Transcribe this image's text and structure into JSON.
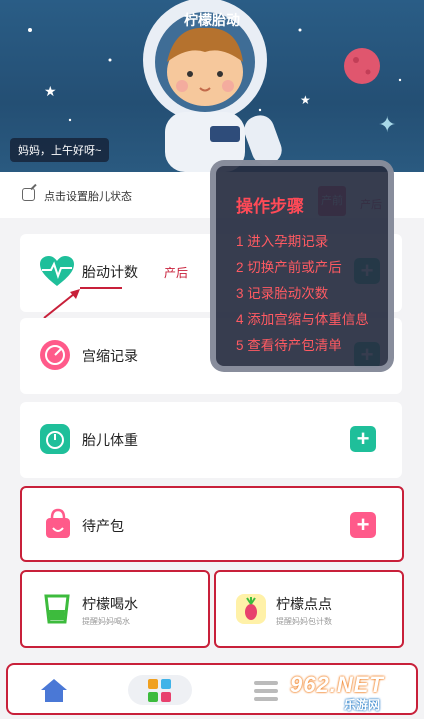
{
  "header": {
    "title": "柠檬胎动",
    "greeting": "妈妈，上午好呀~"
  },
  "status": {
    "label": "点击设置胎儿状态",
    "pre_label": "产前",
    "post_label": "产后"
  },
  "cards": {
    "fetal_movement": {
      "label": "胎动计数",
      "mode": "产后"
    },
    "contraction": {
      "label": "宫缩记录"
    },
    "fetal_weight": {
      "label": "胎儿体重"
    },
    "hospital_bag": {
      "label": "待产包"
    },
    "water": {
      "label": "柠檬喝水",
      "sub": "提醒妈妈喝水"
    },
    "dots": {
      "label": "柠檬点点",
      "sub": "提醒妈妈包计数"
    }
  },
  "overlay": {
    "title": "操作步骤",
    "steps": [
      "1 进入孕期记录",
      "2 切换产前或产后",
      "3 记录胎动次数",
      "4 添加宫缩与体重信息",
      "5 查看待产包清单"
    ]
  },
  "watermark": {
    "main": "962.NET",
    "sub": "乐游网"
  },
  "colors": {
    "accent": "#e8416d",
    "teal": "#1fbf9a",
    "header": "#2a5d86",
    "highlight": "#c8203a"
  },
  "icons": [
    "heart-pulse-icon",
    "gauge-icon",
    "scale-icon",
    "bag-icon",
    "cup-icon",
    "radish-icon",
    "home-icon",
    "grid-icon",
    "list-icon"
  ]
}
